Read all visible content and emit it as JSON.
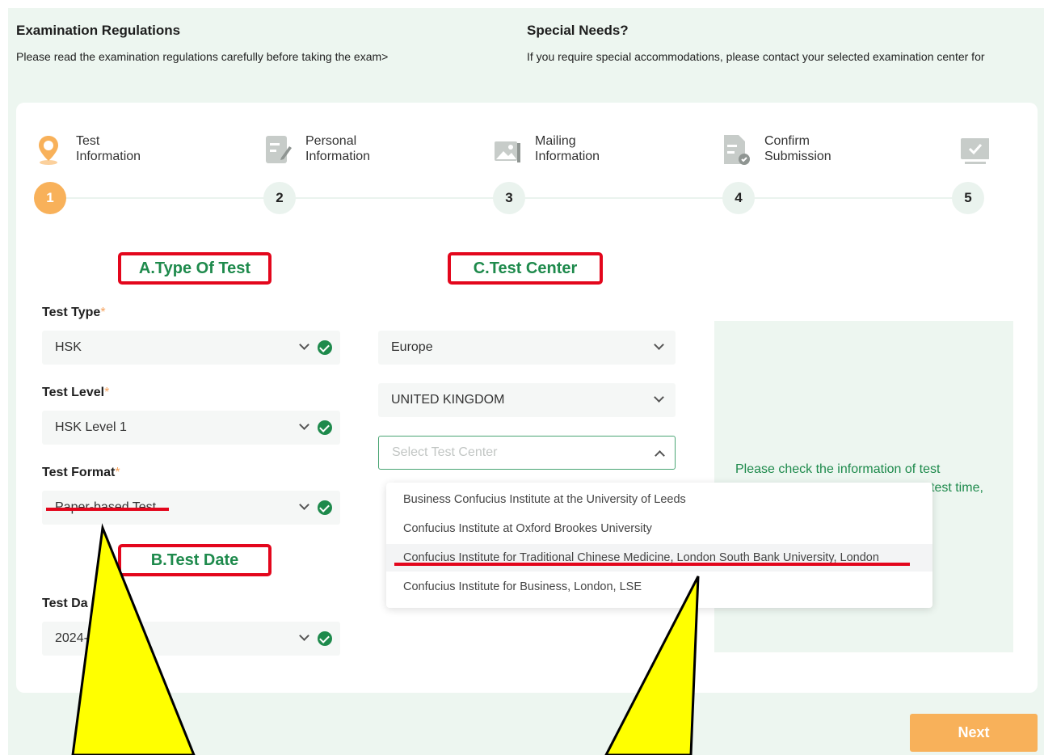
{
  "regulations": {
    "title": "Examination Regulations",
    "text": "Please read the examination regulations carefully before taking the exam>"
  },
  "special_needs": {
    "title": "Special Needs?",
    "text": "If you require special accommodations, please contact your selected examination center for"
  },
  "steps": [
    {
      "line1": "Test",
      "line2": "Information",
      "number": "1",
      "icon": "location-pin-icon"
    },
    {
      "line1": "Personal",
      "line2": "Information",
      "number": "2",
      "icon": "edit-form-icon"
    },
    {
      "line1": "Mailing",
      "line2": "Information",
      "number": "3",
      "icon": "image-mail-icon"
    },
    {
      "line1": "Confirm",
      "line2": "Submission",
      "number": "4",
      "icon": "document-check-icon"
    },
    {
      "line1": "",
      "line2": "",
      "number": "5",
      "icon": "monitor-check-icon"
    }
  ],
  "sections": {
    "type_of_test": "A.Type Of Test",
    "test_date": "B.Test Date",
    "test_center": "C.Test Center"
  },
  "form": {
    "test_type": {
      "label": "Test Type",
      "value": "HSK"
    },
    "test_level": {
      "label": "Test Level",
      "value": "HSK Level 1"
    },
    "test_format": {
      "label": "Test Format",
      "value": "Paper-based Test"
    },
    "test_date": {
      "label": "Test Da",
      "value": "2024-"
    },
    "required_mark": "*",
    "region": {
      "value": "Europe"
    },
    "country": {
      "value": "UNITED KINGDOM"
    },
    "center": {
      "placeholder": "Select Test Center"
    }
  },
  "center_options": [
    "Business Confucius Institute at the University of Leeds",
    "Confucius Institute at Oxford Brookes University",
    "Confucius Institute for Traditional Chinese Medicine, London South Bank University, London",
    "Confucius Institute for Business, London, LSE"
  ],
  "info_panel": {
    "line1": "Please check the information of test",
    "line2": "test time,"
  },
  "next_label": "Next",
  "colors": {
    "accent_green": "#1e8a4c",
    "accent_orange": "#f8b15a",
    "annotation_red": "#e3061c",
    "annotation_yellow": "#ffff00"
  }
}
